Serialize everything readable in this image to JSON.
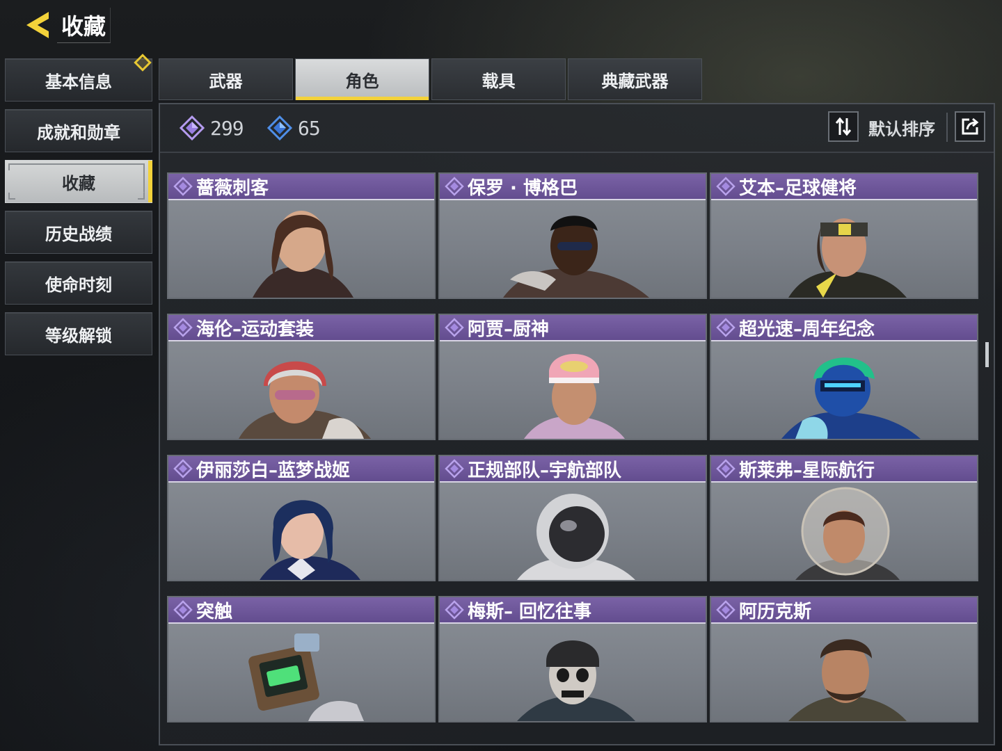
{
  "header": {
    "title": "收藏",
    "back_icon": "chevron-left-icon",
    "accent": "#f3d23a"
  },
  "sidebar": {
    "items": [
      {
        "label": "基本信息",
        "active": false,
        "badge": true
      },
      {
        "label": "成就和勋章",
        "active": false
      },
      {
        "label": "收藏",
        "active": true
      },
      {
        "label": "历史战绩",
        "active": false
      },
      {
        "label": "使命时刻",
        "active": false
      },
      {
        "label": "等级解锁",
        "active": false
      }
    ]
  },
  "tabs": [
    {
      "label": "武器",
      "active": false
    },
    {
      "label": "角色",
      "active": true
    },
    {
      "label": "载具",
      "active": false
    },
    {
      "label": "典藏武器",
      "active": false
    }
  ],
  "toolbar": {
    "counter_a": {
      "icon": "purple-diamond-icon",
      "value": "299"
    },
    "counter_b": {
      "icon": "blue-diamond-icon",
      "value": "65"
    },
    "sort_label": "默认排序",
    "sort_icon": "sort-icon",
    "share_icon": "share-icon"
  },
  "characters": [
    {
      "name": "蔷薇刺客"
    },
    {
      "name": "保罗 · 博格巴"
    },
    {
      "name": "艾本–足球健将"
    },
    {
      "name": "海伦–运动套装"
    },
    {
      "name": "阿贾–厨神"
    },
    {
      "name": "超光速–周年纪念"
    },
    {
      "name": "伊丽莎白–蓝梦战姬"
    },
    {
      "name": "正规部队–宇航部队"
    },
    {
      "name": "斯莱弗–星际航行"
    },
    {
      "name": "突触"
    },
    {
      "name": "梅斯– 回忆往事"
    },
    {
      "name": "阿历克斯"
    }
  ],
  "colors": {
    "rarity_header": "#7a62a6",
    "card_bg": "#7b8088"
  }
}
